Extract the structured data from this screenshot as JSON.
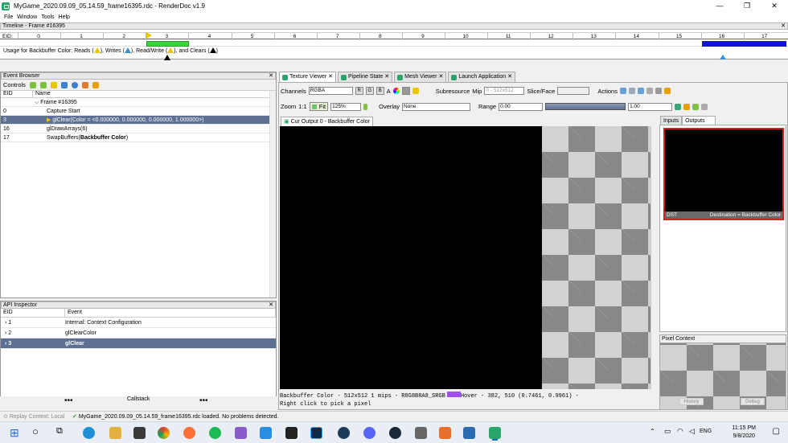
{
  "window": {
    "title": "MyGame_2020.09.09_05.14.59_frame16395.rdc - RenderDoc v1.9",
    "controls": [
      "—",
      "❐",
      "✕"
    ]
  },
  "menu": [
    "File",
    "Window",
    "Tools",
    "Help"
  ],
  "timeline": {
    "title": "Timeline - Frame #16395",
    "eid_label": "EID:",
    "ticks": [
      "0",
      "1",
      "2",
      "3",
      "4",
      "5",
      "6",
      "7",
      "8",
      "9",
      "10",
      "11",
      "12",
      "13",
      "14",
      "15",
      "16",
      "17"
    ],
    "usage_prefix": "Usage for Backbuffer Color: Reads (",
    "usage_reads_close": "), Writes (",
    "usage_writes_close": "), Read/Write (",
    "usage_rw_close": "), and Clears (",
    "usage_end": ")"
  },
  "event_browser": {
    "title": "Event Browser",
    "controls_label": "Controls",
    "columns": [
      "EID",
      "Name"
    ],
    "rows": [
      {
        "eid": "",
        "name": "Frame #16395"
      },
      {
        "eid": "0",
        "name": "Capture Start"
      },
      {
        "eid": "3",
        "name": "glClear(Color = <0.000000, 0.000000, 0.000000, 1.000000>)"
      },
      {
        "eid": "16",
        "name": "glDrawArrays(6)"
      },
      {
        "eid": "17",
        "name": "SwapBuffers(",
        "bold": "Backbuffer Color",
        "end": ")"
      }
    ]
  },
  "api_inspector": {
    "title": "API Inspector",
    "columns": [
      "EID",
      "Event"
    ],
    "rows": [
      {
        "eid": "1",
        "event": "Internal: Context Configuration"
      },
      {
        "eid": "2",
        "event": "glClearColor"
      },
      {
        "eid": "3",
        "event": "glClear"
      }
    ],
    "callstack": "Callstack"
  },
  "status": {
    "context": "Replay Context: Local",
    "message": "MyGame_2020.09.09_05.14.59_frame16395.rdc loaded. No problems detected."
  },
  "tabs": [
    "Texture Viewer",
    "Pipeline State",
    "Mesh Viewer",
    "Launch Application"
  ],
  "texture_viewer": {
    "channels_label": "Channels",
    "channels_value": "RGBA",
    "rgba": [
      "R",
      "G",
      "B",
      "A"
    ],
    "subresource": "Subresource",
    "mip_label": "Mip",
    "mip_value": "0 - 512x512",
    "slice_label": "Slice/Face",
    "actions": "Actions",
    "zoom_label": "Zoom",
    "zoom_11": "1:1",
    "fit": "Fit",
    "zoom_value": "125%",
    "overlay_label": "Overlay",
    "overlay_value": "None",
    "range_label": "Range",
    "range_min": "0.00",
    "range_max": "1.00",
    "output_tab": "Cur Output 0 - Backbuffer Color",
    "info_line1": "Backbuffer Color - 512x512 1 mips - R8G8B8A8_SRGB",
    "hover": "Hover -   382,  510 (0.7461, 0.9961)  -",
    "info_line2": "Right click to pick a pixel",
    "swatch_color": "#a050f0"
  },
  "side": {
    "tabs": [
      "Inputs",
      "Outputs"
    ],
    "thumb_left": "DST",
    "thumb_right": "Destination = Backbuffer Color",
    "pixel_context": "Pixel Context",
    "history": "History",
    "debug": "Debug"
  },
  "taskbar": {
    "time": "11:15 PM",
    "date": "9/8/2020",
    "lang": "ENG"
  }
}
